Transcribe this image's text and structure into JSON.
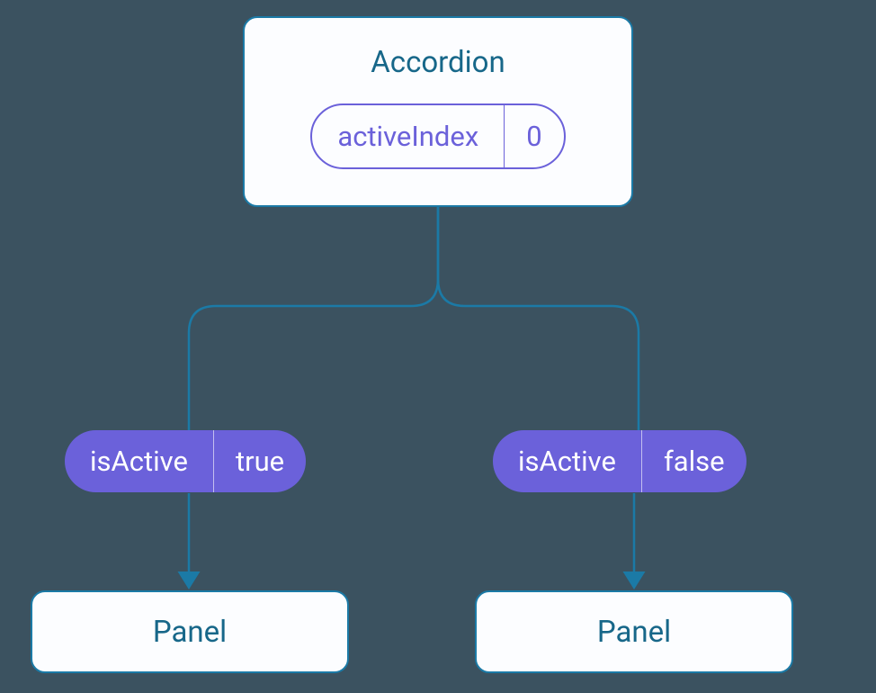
{
  "accordion": {
    "title": "Accordion",
    "state": {
      "name": "activeIndex",
      "value": "0"
    }
  },
  "children": {
    "left": {
      "prop": {
        "name": "isActive",
        "value": "true"
      },
      "label": "Panel"
    },
    "right": {
      "prop": {
        "name": "isActive",
        "value": "false"
      },
      "label": "Panel"
    }
  },
  "colors": {
    "background": "#3b5260",
    "boxBorder": "#1b7aa6",
    "boxBg": "#fcfdff",
    "textTeal": "#176789",
    "purple": "#6b61da"
  }
}
